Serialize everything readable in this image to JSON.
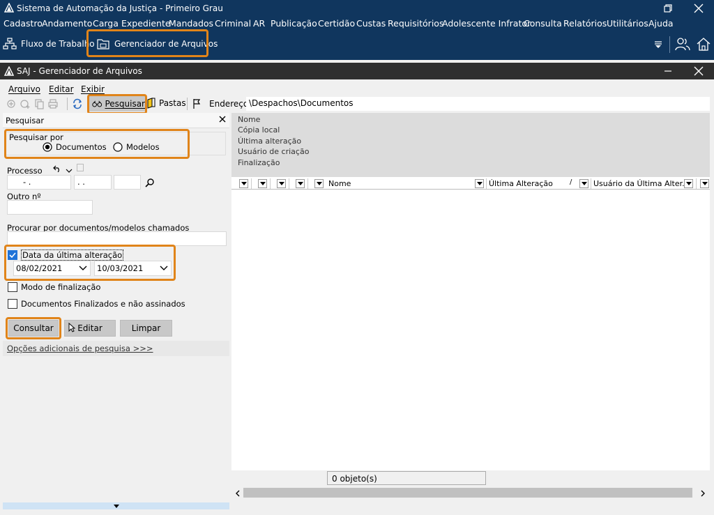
{
  "main_window": {
    "title": "Sistema de Automação da Justiça - Primeiro Grau",
    "menu": [
      "Cadastro",
      "Andamento",
      "Carga",
      "Expediente",
      "Mandados",
      "Criminal",
      "AR",
      "Publicação",
      "Certidão",
      "Custas",
      "Requisitórios",
      "Adolescente Infrator",
      "Consulta",
      "Relatórios",
      "Utilitários",
      "Ajuda"
    ],
    "toolbar": {
      "fluxo_label": "Fluxo de Trabalho",
      "gerenciador_label": "Gerenciador de Arquivos"
    }
  },
  "sub_window": {
    "title": "SAJ - Gerenciador de Arquivos",
    "menu": [
      "Arquivo",
      "Editar",
      "Exibir"
    ],
    "toolbar": {
      "pesquisar_label": "Pesquisar",
      "pastas_label": "Pastas",
      "endereco_label": "Endereço",
      "endereco_value": "\\Despachos\\Documentos"
    }
  },
  "search_panel": {
    "header": "Pesquisar",
    "pesquisar_por_label": "Pesquisar por",
    "radio_documentos": "Documentos",
    "radio_modelos": "Modelos",
    "radio_selected": "Documentos",
    "processo_label": "Processo",
    "processo_part1": "   -   .",
    "processo_part2": ".   .",
    "outro_label": "Outro nº",
    "procurar_label": "Procurar por documentos/modelos chamados",
    "data_alteracao_label": "Data da última alteração",
    "data_alteracao_checked": true,
    "date_from": "08/02/2021",
    "date_to": "10/03/2021",
    "modo_finalizacao_label": "Modo de finalização",
    "docs_finalizados_label": "Documentos Finalizados e não assinados",
    "btn_consultar": "Consultar",
    "btn_editar": "Editar",
    "btn_limpar": "Limpar",
    "opcoes_link": "Opções adicionais de pesquisa >>>"
  },
  "details": {
    "nome": "Nome",
    "copia_local": "Cópia local",
    "ultima_alteracao": "Última alteração",
    "usuario_criacao": "Usuário de criação",
    "finalizacao": "Finalização"
  },
  "grid": {
    "col_nome": "Nome",
    "col_ultima_alteracao": "Última Alteração",
    "col_usuario": "Usuário da Última Alter...",
    "status": "0 objeto(s)"
  },
  "colors": {
    "titlebar": "#10365e",
    "highlight": "#e0841a",
    "sub_titlebar": "#2f2f2f"
  }
}
